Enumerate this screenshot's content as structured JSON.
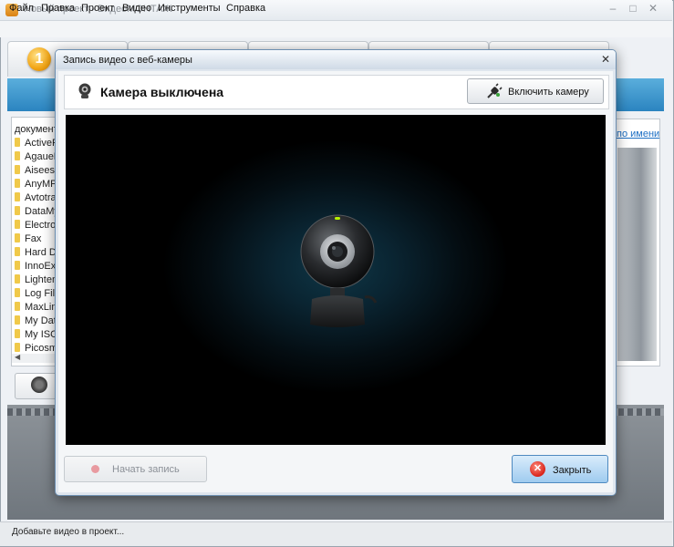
{
  "window": {
    "title": "Новый проект - ВидеоМОНТАЖ",
    "controls": {
      "minimize": "–",
      "maximize": "□",
      "close": "✕"
    }
  },
  "menu": [
    "Файл",
    "Правка",
    "Проект",
    "Видео",
    "Инструменты",
    "Справка"
  ],
  "steps": {
    "active_badge": "1"
  },
  "files": {
    "header": "документы",
    "folders": [
      "ActiveP",
      "AgaueE",
      "Aiseesc",
      "AnyMP",
      "Avtotra",
      "DataMy",
      "Electro",
      "Fax",
      "Hard D",
      "InnoExt",
      "Lighten",
      "Log File",
      "MaxLim",
      "My Dat",
      "My ISO",
      "Picosm"
    ],
    "scroll_left_arrow": "◀"
  },
  "sort": {
    "link_text": "по имени"
  },
  "status": {
    "text": "Добавьте видео в проект..."
  },
  "dialog": {
    "title": "Запись видео с веб-камеры",
    "close_glyph": "✕",
    "camera_status": "Камера выключена",
    "enable_camera_label": "Включить камеру",
    "start_record_label": "Начать запись",
    "close_label": "Закрыть",
    "close_icon_glyph": "✕"
  },
  "colors": {
    "accent_blue": "#2b84c0",
    "close_button": "#9fcbef",
    "record_dot_disabled": "#e89aa0",
    "close_icon": "#d8241b"
  },
  "icons": [
    "app-icon",
    "webcam-icon",
    "plug-icon",
    "record-dot-icon",
    "close-icon",
    "folder-icon"
  ]
}
